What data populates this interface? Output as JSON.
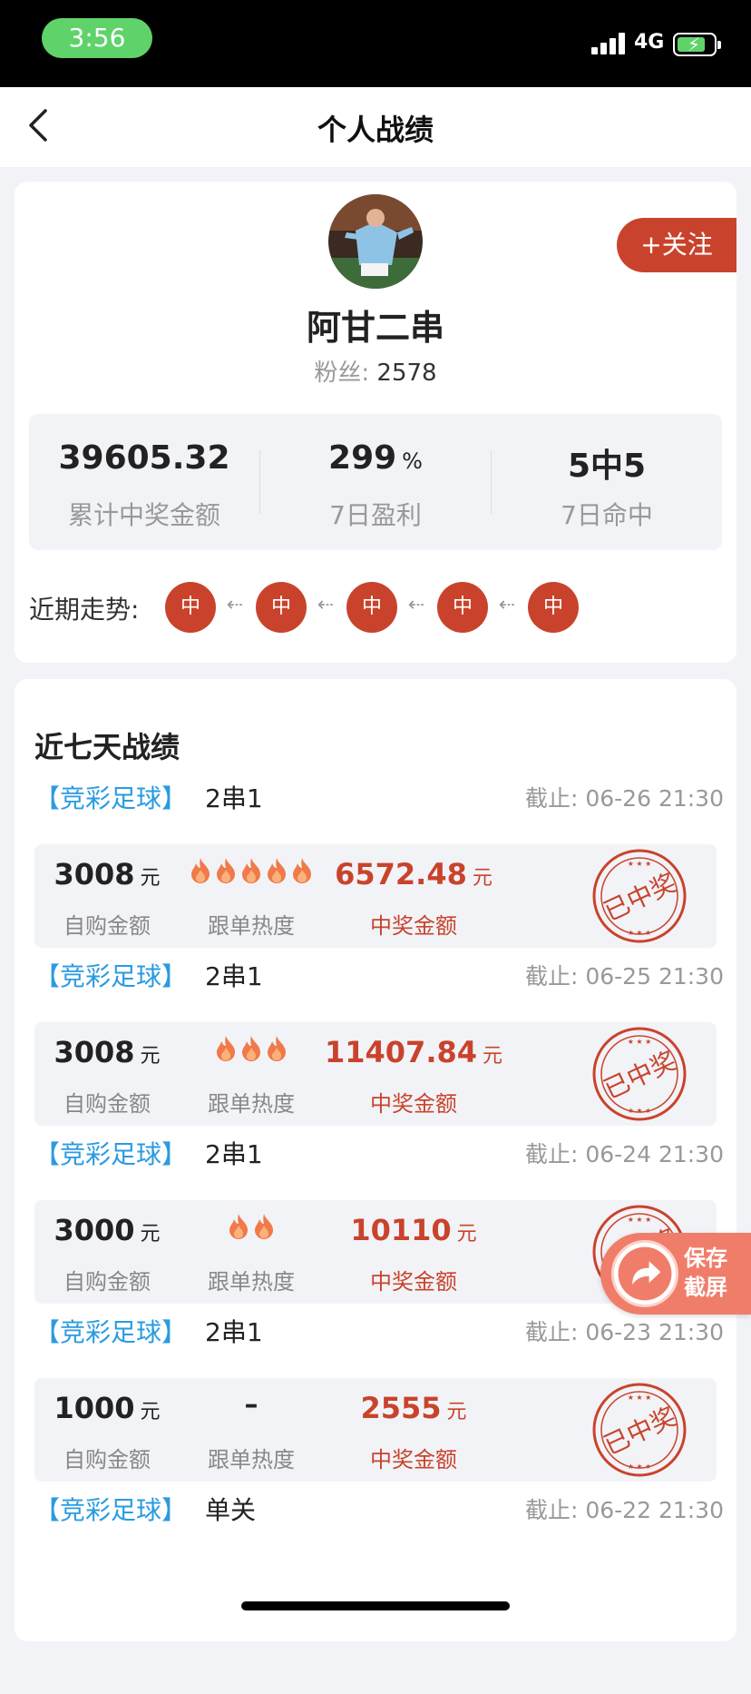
{
  "status_bar": {
    "time": "3:56",
    "network": "4G"
  },
  "nav": {
    "title": "个人战绩"
  },
  "profile": {
    "name": "阿甘二串",
    "fans_label": "粉丝:",
    "fans_count": "2578",
    "follow_label": "+关注"
  },
  "stats": [
    {
      "value": "39605.32",
      "unit": "",
      "label": "累计中奖金额"
    },
    {
      "value": "299",
      "unit": "%",
      "label": "7日盈利"
    },
    {
      "value": "5中5",
      "unit": "",
      "label": "7日命中"
    }
  ],
  "trend": {
    "label": "近期走势:",
    "items": [
      "中",
      "中",
      "中",
      "中",
      "中"
    ]
  },
  "records_section": {
    "title": "近七天战绩",
    "buy_label": "自购金额",
    "heat_label": "跟单热度",
    "win_label": "中奖金额",
    "unit": "元",
    "stamp_text": "已中奖",
    "records": [
      {
        "category": "【竞彩足球】",
        "type": "2串1",
        "deadline": "截止: 06-26 21:30",
        "buy_amount": "3008",
        "heat": 5,
        "heat_text": "",
        "win_amount": "6572.48"
      },
      {
        "category": "【竞彩足球】",
        "type": "2串1",
        "deadline": "截止: 06-25 21:30",
        "buy_amount": "3008",
        "heat": 3,
        "heat_text": "",
        "win_amount": "11407.84"
      },
      {
        "category": "【竞彩足球】",
        "type": "2串1",
        "deadline": "截止: 06-24 21:30",
        "buy_amount": "3000",
        "heat": 2,
        "heat_text": "",
        "win_amount": "10110"
      },
      {
        "category": "【竞彩足球】",
        "type": "2串1",
        "deadline": "截止: 06-23 21:30",
        "buy_amount": "1000",
        "heat": 0,
        "heat_text": "–",
        "win_amount": "2555"
      },
      {
        "category": "【竞彩足球】",
        "type": "单关",
        "deadline": "截止: 06-22 21:30",
        "buy_amount": "",
        "heat": 0,
        "heat_text": "",
        "win_amount": ""
      }
    ]
  },
  "save_screenshot": {
    "line1": "保存",
    "line2": "截屏"
  },
  "colors": {
    "accent": "#c9432c",
    "category": "#2a9be0",
    "background": "#f2f3f7"
  }
}
